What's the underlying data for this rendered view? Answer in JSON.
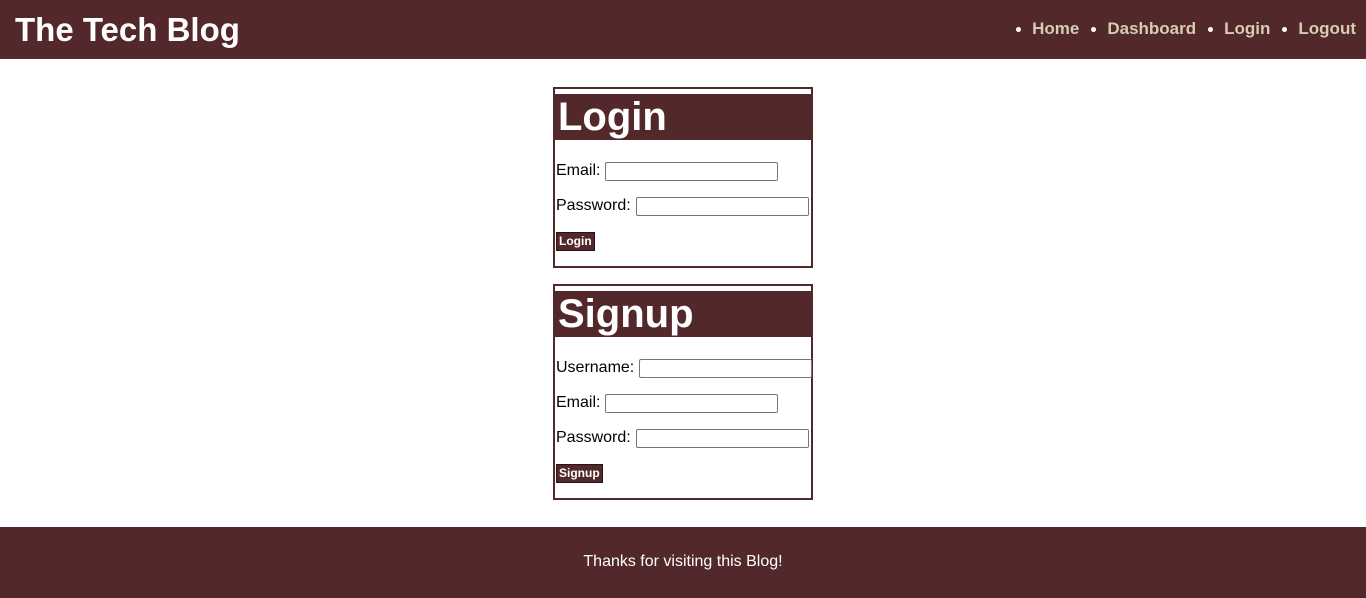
{
  "header": {
    "title": "The Tech Blog",
    "nav": [
      {
        "label": "Home"
      },
      {
        "label": "Dashboard"
      },
      {
        "label": "Login"
      },
      {
        "label": "Logout"
      }
    ]
  },
  "login": {
    "title": "Login",
    "email_label": "Email:",
    "email_value": "",
    "password_label": "Password:",
    "password_value": "",
    "button_label": "Login"
  },
  "signup": {
    "title": "Signup",
    "username_label": "Username:",
    "username_value": "",
    "email_label": "Email:",
    "email_value": "",
    "password_label": "Password:",
    "password_value": "",
    "button_label": "Signup"
  },
  "footer": {
    "text": "Thanks for visiting this Blog!"
  },
  "colors": {
    "brand": "#52282a",
    "nav_link": "#d5ccb2",
    "heading_text": "#ffffff"
  }
}
